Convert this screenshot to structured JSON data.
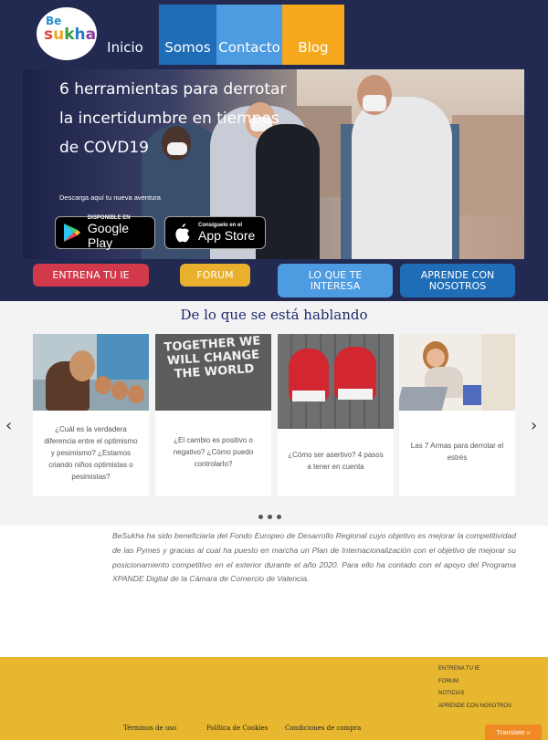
{
  "brand": {
    "logo_top": "Be",
    "logo_bottom": [
      "s",
      "u",
      "k",
      "h",
      "a"
    ]
  },
  "nav": {
    "inicio": "Inicio",
    "somos": "Somos",
    "contacto": "Contacto",
    "blog": "Blog"
  },
  "hero": {
    "title": "6 herramientas para derrotar la incertidumbre en tiempos de COVD19",
    "subtitle": "Descarga aquí tu nueva aventura",
    "google_small": "DISPONIBLE EN",
    "google_big": "Google Play",
    "apple_small": "Consíguelo en el",
    "apple_big": "App Store"
  },
  "cta": {
    "entrena": "ENTRENA TU IE",
    "forum": "FORUM",
    "interesa": "LO QUE TE INTERESA",
    "aprende": "APRENDE CON NOSOTROS"
  },
  "carousel": {
    "title": "De lo que se está hablando",
    "cards": [
      {
        "caption": "¿Cuál es la verdadera diferencia entre el optimismo y pesimismo? ¿Estamos criando niños optimistas o pesimistas?",
        "image": "eggs-photo"
      },
      {
        "caption": "¿El cambio es positivo o negativo? ¿Cómo puedo controlarlo?",
        "image": "chalk-board-photo",
        "image_text": "TOGETHER WE WILL CHANGE THE WORLD"
      },
      {
        "caption": "¿Cómo ser asertivo? 4 pasos a tener en cuenta",
        "image": "boxing-gloves-photo"
      },
      {
        "caption": "Las 7 Armas para derrotar el estrés",
        "image": "stressed-woman-photo"
      }
    ],
    "prev": "‹",
    "next": "›"
  },
  "body_text": "BeSukha ha sido beneficiaria del Fondo Europeo de Desarrollo Regional cuyo objetivo es mejorar la competitividad de las Pymes y gracias al cual ha puesto en marcha un Plan de Internacionalización con el objetivo de mejorar su posicionamiento competitivo en el exterior durante el año 2020. Para ello ha contado con el apoyo del Programa XPANDE Digital de la Cámara de Comercio de Valencia.",
  "footer": {
    "links": [
      "ENTRENA TU IE",
      "FORUM",
      "NOTICIAS",
      "APRENDE CON NOSOTROS"
    ],
    "terminos": "Términos de uso",
    "cookies": "Política de Cookies",
    "condiciones": "Condiciones de compra",
    "translate": "Translate »"
  },
  "colors": {
    "header_bg": "#222a52",
    "somos": "#1f6db7",
    "contacto": "#4d9be0",
    "blog": "#f5a81b",
    "entrena": "#d23a4b",
    "forum": "#e8b02d",
    "footer": "#e6b72f",
    "title": "#1f2a6e"
  }
}
